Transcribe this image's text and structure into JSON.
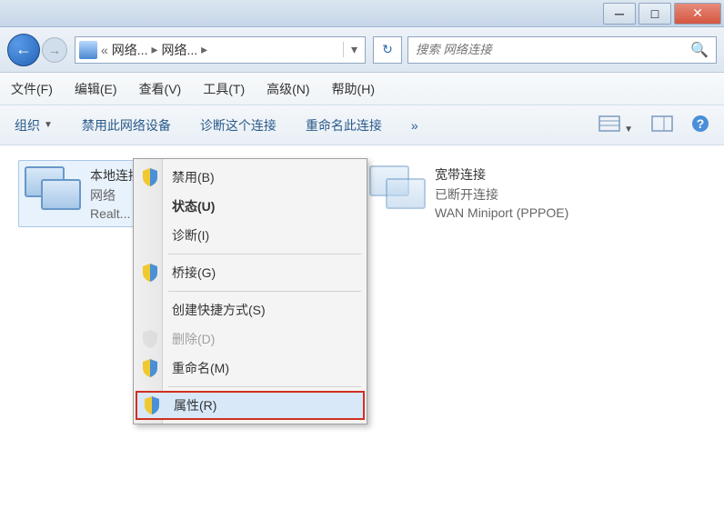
{
  "breadcrumb": {
    "item1": "网络...",
    "item2": "网络..."
  },
  "search": {
    "placeholder": "搜索 网络连接"
  },
  "menu": {
    "file": "文件(F)",
    "edit": "编辑(E)",
    "view": "查看(V)",
    "tools": "工具(T)",
    "advanced": "高级(N)",
    "help": "帮助(H)"
  },
  "toolbar": {
    "organize": "组织",
    "disable": "禁用此网络设备",
    "diagnose": "诊断这个连接",
    "rename": "重命名此连接",
    "overflow": "»"
  },
  "connections": {
    "local": {
      "title": "本地连接",
      "status": "网络",
      "device": "Realt..."
    },
    "broadband": {
      "title": "宽带连接",
      "status": "已断开连接",
      "device": "WAN Miniport (PPPOE)"
    }
  },
  "context_menu": {
    "disable": "禁用(B)",
    "status": "状态(U)",
    "diagnose": "诊断(I)",
    "bridge": "桥接(G)",
    "shortcut": "创建快捷方式(S)",
    "delete": "删除(D)",
    "rename": "重命名(M)",
    "properties": "属性(R)"
  }
}
